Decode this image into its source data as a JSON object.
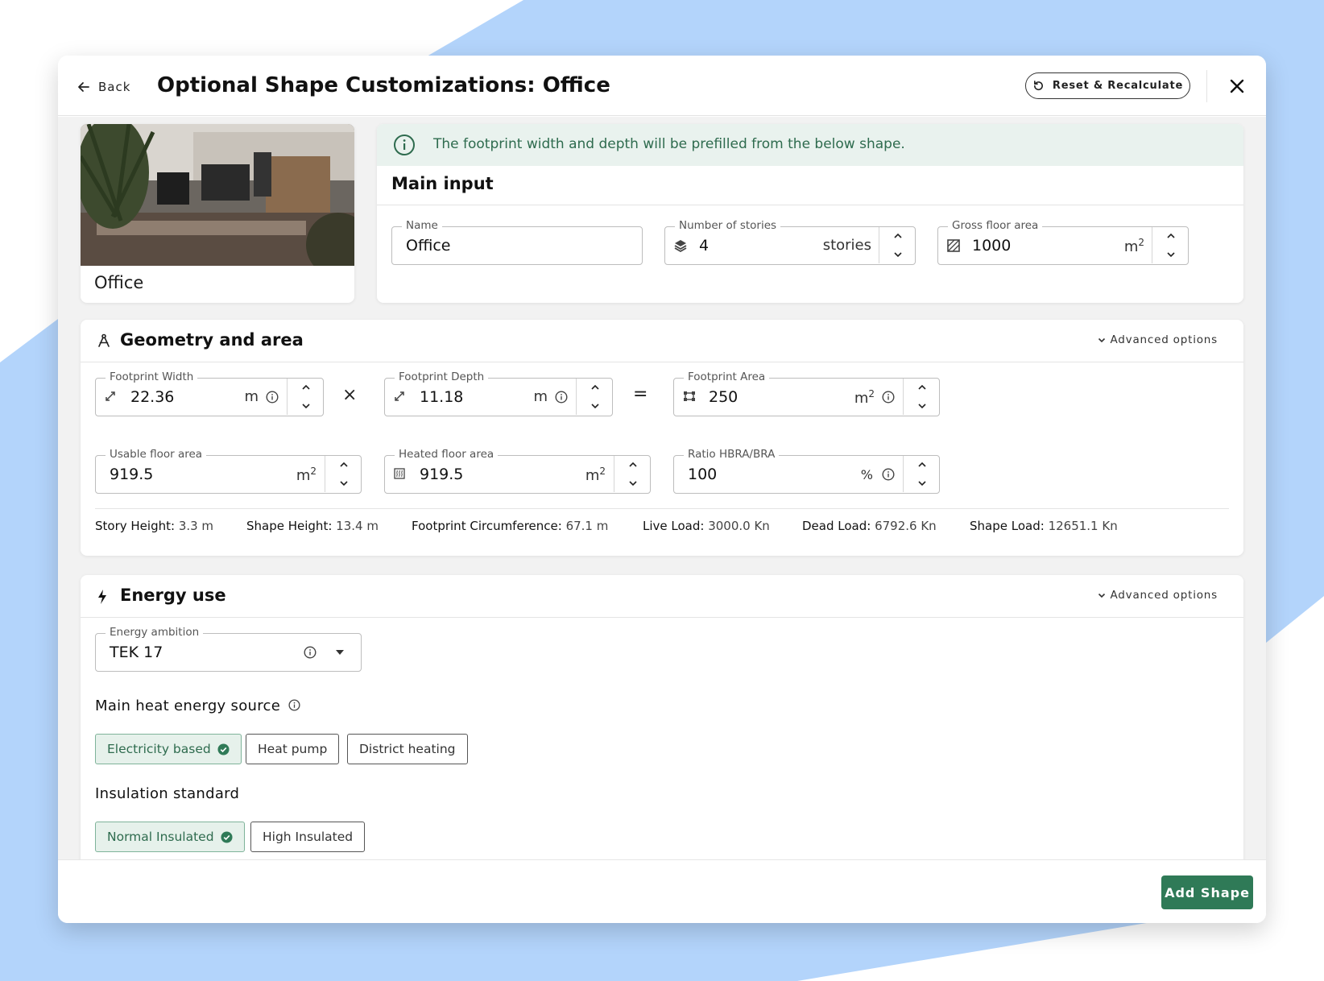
{
  "header": {
    "back_label": "Back",
    "title": "Optional Shape Customizations: Office",
    "reset_label": "Reset & Recalculate"
  },
  "shape_preview": {
    "label": "Office"
  },
  "main_input": {
    "info_banner": "The footprint width and depth will be prefilled from the below shape.",
    "title": "Main input",
    "name": {
      "label": "Name",
      "value": "Office"
    },
    "stories": {
      "label": "Number of stories",
      "value": "4",
      "unit": "stories"
    },
    "gross_floor_area": {
      "label": "Gross floor area",
      "value": "1000",
      "unit": "m",
      "unit_sup": "2"
    }
  },
  "geometry": {
    "title": "Geometry and area",
    "advanced_label": "Advanced options",
    "footprint_width": {
      "label": "Footprint Width",
      "value": "22.36",
      "unit": "m"
    },
    "times_sign": "×",
    "footprint_depth": {
      "label": "Footprint Depth",
      "value": "11.18",
      "unit": "m"
    },
    "equals_sign": "=",
    "footprint_area": {
      "label": "Footprint Area",
      "value": "250",
      "unit": "m",
      "unit_sup": "2"
    },
    "usable_floor_area": {
      "label": "Usable floor area",
      "value": "919.5",
      "unit": "m",
      "unit_sup": "2"
    },
    "heated_floor_area": {
      "label": "Heated floor area",
      "value": "919.5",
      "unit": "m",
      "unit_sup": "2"
    },
    "ratio": {
      "label": "Ratio HBRA/BRA",
      "value": "100",
      "unit": "%"
    },
    "stats": [
      {
        "key": "Story Height:",
        "value": "3.3 m"
      },
      {
        "key": "Shape Height:",
        "value": "13.4 m"
      },
      {
        "key": "Footprint Circumference:",
        "value": "67.1 m"
      },
      {
        "key": "Live Load:",
        "value": "3000.0 Kn"
      },
      {
        "key": "Dead Load:",
        "value": "6792.6 Kn"
      },
      {
        "key": "Shape Load:",
        "value": "12651.1 Kn"
      }
    ]
  },
  "energy": {
    "title": "Energy use",
    "advanced_label": "Advanced options",
    "ambition": {
      "label": "Energy ambition",
      "value": "TEK 17"
    },
    "heat_source_heading": "Main heat energy source",
    "heat_sources": [
      {
        "label": "Electricity based",
        "selected": true
      },
      {
        "label": "Heat pump",
        "selected": false
      },
      {
        "label": "District heating",
        "selected": false
      }
    ],
    "insulation_heading": "Insulation standard",
    "insulation_options": [
      {
        "label": "Normal Insulated",
        "selected": true
      },
      {
        "label": "High Insulated",
        "selected": false
      }
    ]
  },
  "footer": {
    "add_label": "Add Shape"
  },
  "colors": {
    "background_blue": "#b3d4fb",
    "accent_green": "#2f7a57",
    "selected_chip_bg": "#e6f1eb",
    "info_banner_bg": "#e9f2ee"
  }
}
